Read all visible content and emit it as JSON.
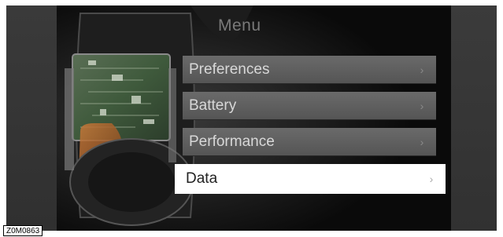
{
  "menu": {
    "title": "Menu",
    "items": [
      {
        "label": "Preferences",
        "selected": false
      },
      {
        "label": "Battery",
        "selected": false
      },
      {
        "label": "Performance",
        "selected": false
      },
      {
        "label": "Data",
        "selected": true
      }
    ]
  },
  "image_code": "Z0M0863",
  "icons": {
    "chevron": "chevron-right-icon"
  }
}
